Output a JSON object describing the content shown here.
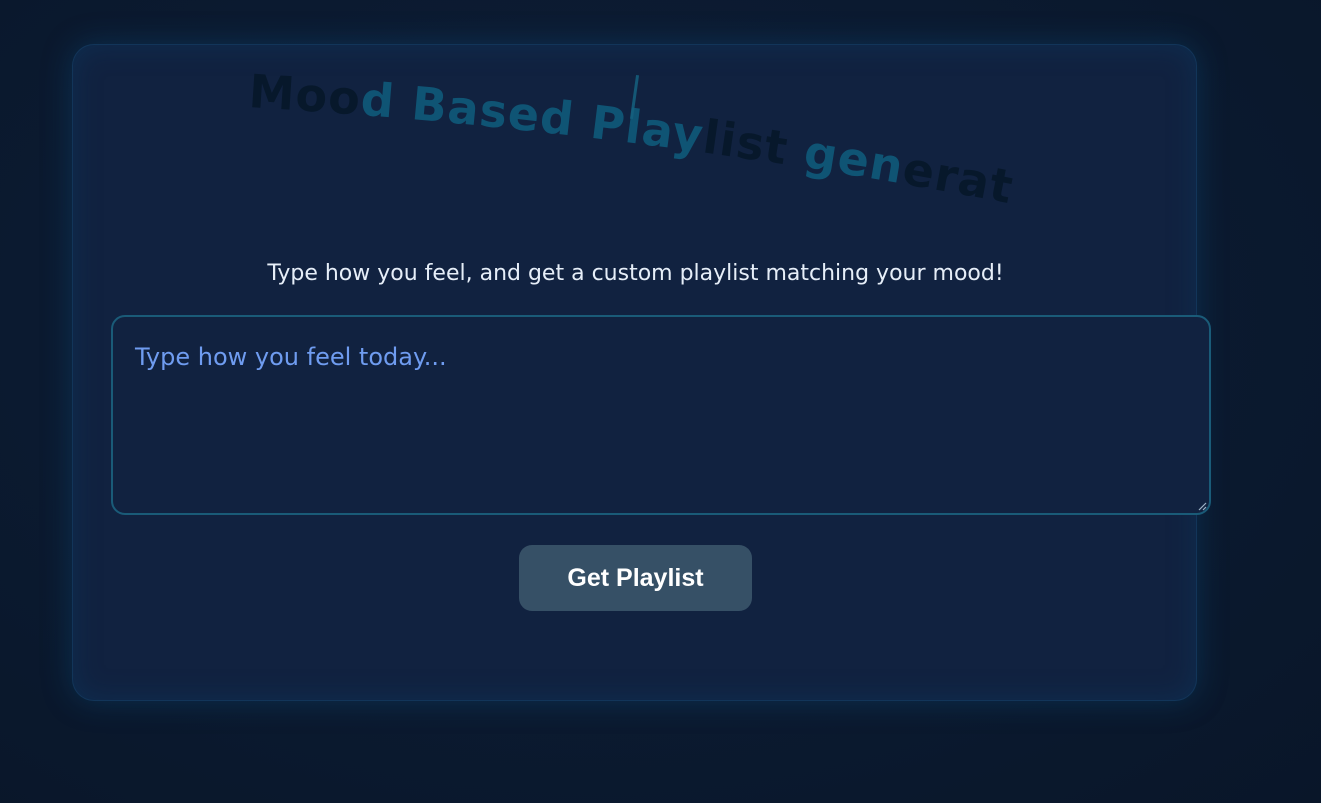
{
  "header": {
    "title_parts": [
      "Moo",
      "d Based Play",
      "list ",
      "gen",
      "erator"
    ]
  },
  "intro": {
    "text": "Type how you feel, and get a custom playlist matching your mood!"
  },
  "mood_input": {
    "value": "",
    "placeholder": "Type how you feel today..."
  },
  "actions": {
    "submit_label": "Get Playlist"
  },
  "colors": {
    "background": "#0b1a30",
    "card": "#112240",
    "accent_teal": "#15607f",
    "placeholder": "#6f9cf0",
    "button": "#365066"
  },
  "icons": {
    "resize_handle": "resize-grip-icon"
  }
}
